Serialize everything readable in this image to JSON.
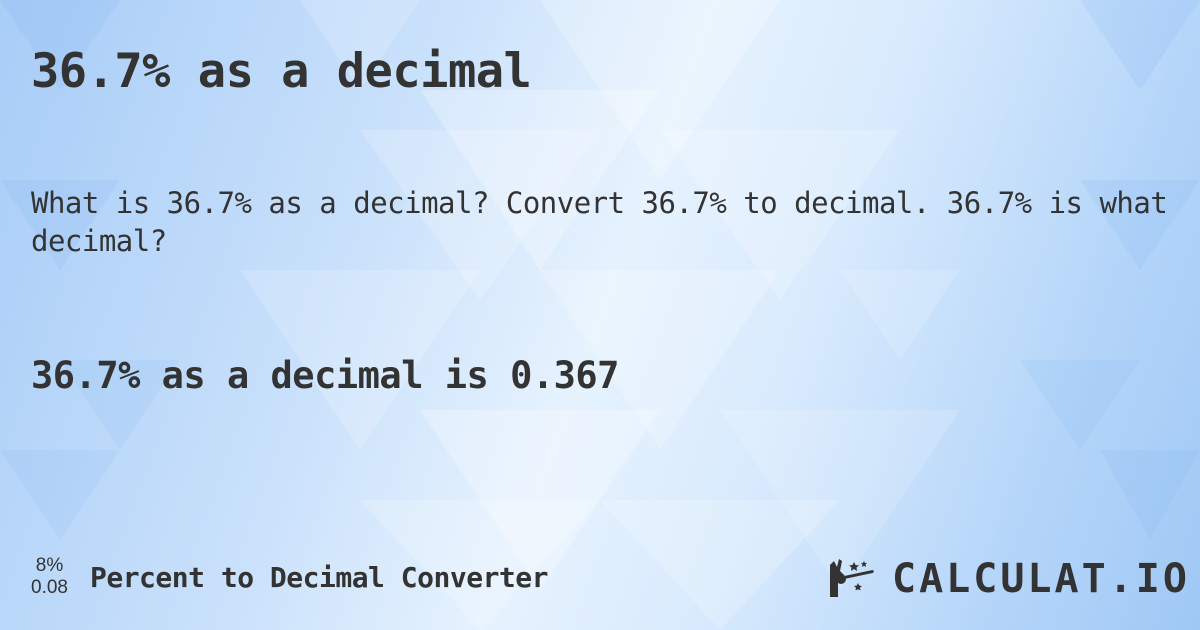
{
  "title": "36.7% as a decimal",
  "question": "What is 36.7% as a decimal? Convert 36.7% to decimal. 36.7% is what decimal?",
  "answer": "36.7% as a decimal is 0.367",
  "footer": {
    "icon_top": "8%",
    "icon_bottom": "0.08",
    "converter_title": "Percent to Decimal Converter"
  },
  "logo": {
    "icon": "magic-hand-wand-icon",
    "text": "CALCULAT.IO"
  },
  "colors": {
    "text": "#333333",
    "background_light": "#e6f2fe",
    "background_blue": "#a8cdf7"
  }
}
